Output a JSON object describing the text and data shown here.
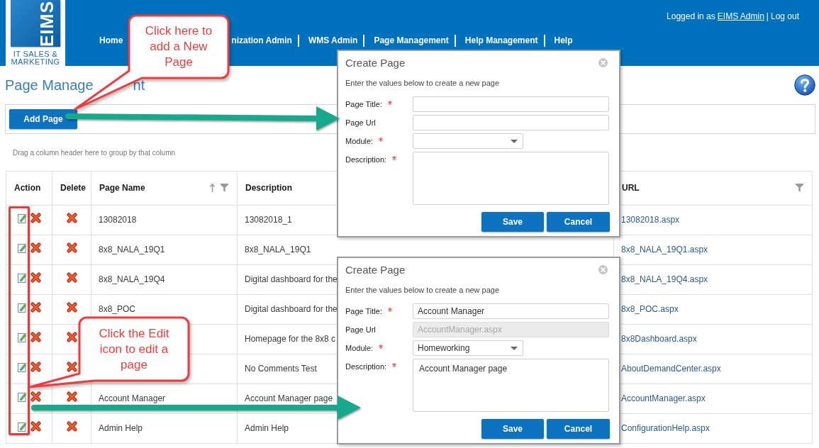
{
  "logo": {
    "mark": "EIMS",
    "tagline": "IT SALES & MARKETING"
  },
  "user_bar": {
    "prefix": "Logged in as",
    "user": "EIMS Admin",
    "separator": "|",
    "logout": "Log out"
  },
  "nav": [
    "Home",
    "nization Admin",
    "WMS Admin",
    "Page Management",
    "Help Management",
    "Help"
  ],
  "page_title": [
    "Page Manage",
    "nt"
  ],
  "toolbar": {
    "add_button": "Add Page"
  },
  "group_hint": "Drag a column header here to group by that column",
  "table": {
    "columns": [
      {
        "label": "Action",
        "sorted": false,
        "filterable": false
      },
      {
        "label": "Delete",
        "sorted": false,
        "filterable": false
      },
      {
        "label": "Page Name",
        "sorted": true,
        "filterable": true
      },
      {
        "label": "Description",
        "sorted": false,
        "filterable": false
      },
      {
        "label": "URL",
        "sorted": false,
        "filterable": true
      }
    ],
    "rows": [
      {
        "page_name": "13082018",
        "description": "13082018_1",
        "url": "13082018.aspx"
      },
      {
        "page_name": "8x8_NALA_19Q1",
        "description": "8x8_NALA_19Q1",
        "url": "8x8_NALA_19Q1.aspx"
      },
      {
        "page_name": "8x8_NALA_19Q4",
        "description": "Digital dashboard for the",
        "url": "8x8_NALA_19Q4.aspx"
      },
      {
        "page_name": "8x8_POC",
        "description": "Digital dashboard for the",
        "url": "8x8_POC.aspx"
      },
      {
        "description": "Homepage for the 8x8 c",
        "url": "8x8Dashboard.aspx"
      },
      {
        "description": "No Comments Test",
        "url": "AboutDemandCenter.aspx"
      },
      {
        "page_name": "Account Manager",
        "description": "Account Manager page",
        "url": "AccountManager.aspx"
      },
      {
        "page_name": "Admin Help",
        "description": "Admin Help",
        "url": "ConfigurationHelp.aspx"
      }
    ]
  },
  "dialogs": [
    {
      "title": "Create Page",
      "instructions": "Enter the values below to create a new page",
      "fields": [
        {
          "label": "Page Title:",
          "kind": "text",
          "required": true,
          "disabled": false
        },
        {
          "label": "Page Url",
          "kind": "text",
          "required": false,
          "disabled": false
        },
        {
          "label": "Module:",
          "kind": "select",
          "required": true,
          "disabled": false
        },
        {
          "label": "Description:",
          "kind": "textarea",
          "required": true,
          "disabled": false
        }
      ],
      "buttons": [
        "Save",
        "Cancel"
      ]
    },
    {
      "title": "Create Page",
      "instructions": "Enter the values below to create a new page",
      "fields": [
        {
          "label": "Page Title:",
          "kind": "text",
          "required": true,
          "disabled": false,
          "value": "Account Manager"
        },
        {
          "label": "Page Url",
          "kind": "text",
          "required": false,
          "disabled": true,
          "value": "AccountManager.aspx"
        },
        {
          "label": "Module:",
          "kind": "select",
          "required": true,
          "disabled": false,
          "value": "Homeworking"
        },
        {
          "label": "Description:",
          "kind": "textarea",
          "required": true,
          "disabled": false,
          "value": "Account Manager page"
        }
      ],
      "buttons": [
        "Save",
        "Cancel"
      ]
    }
  ],
  "annotations": {
    "callouts": [
      "Click here to add a New Page",
      "Click the Edit icon to edit a page"
    ]
  }
}
